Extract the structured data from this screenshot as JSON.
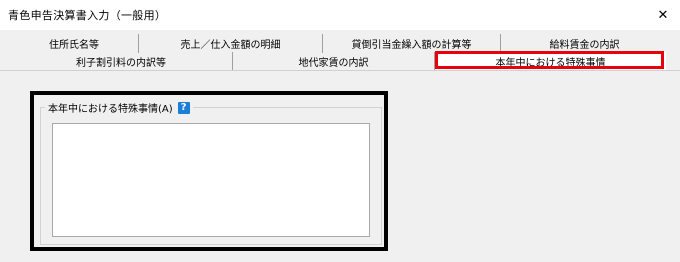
{
  "window": {
    "title": "青色申告決算書入力（一般用）",
    "close_glyph": "✕"
  },
  "tabs": {
    "row1": [
      {
        "label": "住所氏名等"
      },
      {
        "label": "売上／仕入金額の明細"
      },
      {
        "label": "貸倒引当金繰入額の計算等"
      },
      {
        "label": "給料賃金の内訳"
      }
    ],
    "row2": [
      {
        "label": "利子割引料の内訳等"
      },
      {
        "label": "地代家賃の内訳"
      },
      {
        "label": "本年中における特殊事情"
      }
    ]
  },
  "panel": {
    "group_label": "本年中における特殊事情(A)",
    "help_icon_text": "?",
    "textarea_value": ""
  },
  "colors": {
    "highlight": "#e8000b",
    "help_icon": "#1c7ed6"
  }
}
